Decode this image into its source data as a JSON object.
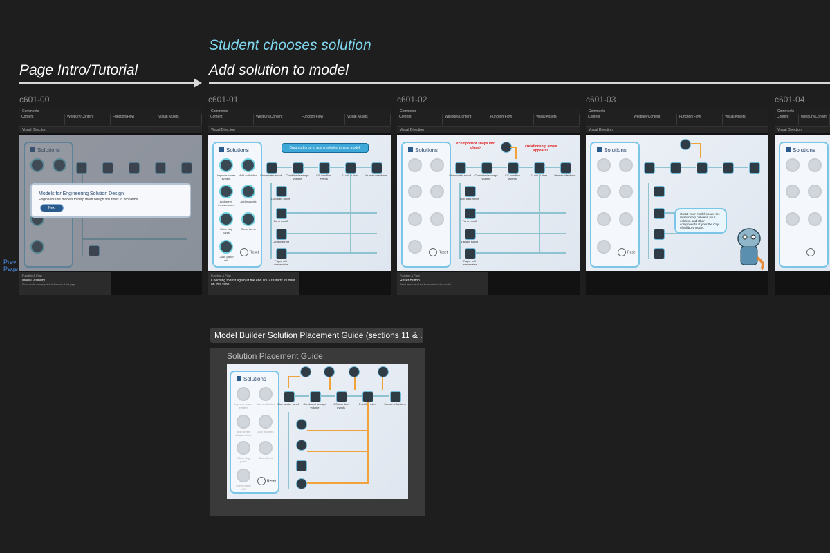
{
  "flow": {
    "intro_label": "Page Intro/Tutorial",
    "choose_label": "Student chooses solution",
    "add_label": "Add solution to model"
  },
  "frames": [
    {
      "id": "c601-00",
      "notes_header": "Function & Flow",
      "notes_text": "Modal Visibility",
      "notes_sub": "Show modal on every visit to the start of this page"
    },
    {
      "id": "c601-01",
      "notes_header": "Function & Flow",
      "notes_text": "Choosing to test again at the end c602 restarts student on this slide",
      "notes_sub": ""
    },
    {
      "id": "c601-02",
      "notes_header": "Function & Flow",
      "notes_text": "Reset Button",
      "notes_sub": "Reset removes all solutions added to the model"
    },
    {
      "id": "c601-03",
      "notes_header": "",
      "notes_text": "",
      "notes_sub": ""
    },
    {
      "id": "c601-04",
      "notes_header": "",
      "notes_text": "",
      "notes_sub": ""
    }
  ],
  "common": {
    "comments_header": "Comments",
    "comment_cols": [
      "Content",
      "Wellbury/Content",
      "Function/Flow",
      "Visual Assets"
    ],
    "visual_header": "Visual Direction",
    "solutions_title": "Solutions",
    "reset_label": "Reset"
  },
  "solutions": [
    "Improve sewer system",
    "Add antibiotics",
    "Add green infrastructure",
    "Add mussels",
    "Close dog parks",
    "Close farms",
    "Close paper mill"
  ],
  "model_nodes": [
    "Stormwater runoff",
    "Combined sewage volume",
    "CS overflow events",
    "E. coli in river",
    "Human infections",
    "Dog park runoff",
    "Farm runoff",
    "Landfill runoff",
    "Paper mill wastewater"
  ],
  "modal": {
    "title": "Models for Engineering Solution Design",
    "subtitle": "Engineers use models to help them design solutions to problems.",
    "button": "Next"
  },
  "callouts": {
    "drag_drop": "Drag and drop to add a solution to your model.",
    "component_snaps": "<component snaps into place>",
    "relationship_arrow": "<relationship arrow appears>",
    "great_bubble": "Great! Your model shows the relationship between your solution and other components of your the City of Millbury model."
  },
  "nav": {
    "prev_page": "Prev Page"
  },
  "guide": {
    "tag": "Model Builder Solution Placement Guide (sections 11 & ...",
    "title": "Solution Placement Guide"
  },
  "colors": {
    "background": "#1e1e1e",
    "accent": "#7fd7ee",
    "wire": "#8fc3d0",
    "highlight": "#f0a33a"
  }
}
